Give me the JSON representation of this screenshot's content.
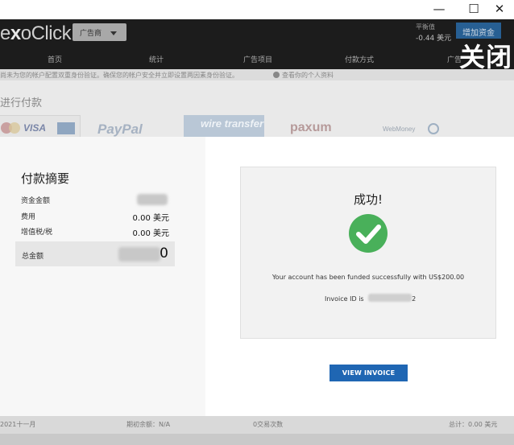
{
  "window": {
    "minimize": "—",
    "maximize": "☐",
    "close": "✕"
  },
  "header": {
    "logo_prefix": "e",
    "logo_mid": "x",
    "logo_rest": "oClick",
    "account_type": "广告商",
    "balance_label": "平衡值",
    "balance_value": "-0.44 美元",
    "add_funds": "增加资金",
    "close_overlay": "关闭",
    "nav": [
      "首页",
      "统计",
      "广告项目",
      "付款方式",
      "广告"
    ]
  },
  "notice": {
    "text": "尚未为您的帐户配置双重身份验证。确保您的帐户安全并立即设置两因素身份验证。",
    "profile_link": "查看你的个人资料"
  },
  "payments": {
    "heading": "进行付款",
    "methods": [
      "VISA",
      "PayPal",
      "wire transfer",
      "paxum",
      "WebMoney"
    ]
  },
  "summary": {
    "title": "付款摘要",
    "rows": [
      {
        "label": "资金金额",
        "value": ""
      },
      {
        "label": "费用",
        "value": "0.00 美元"
      },
      {
        "label": "增值税/税",
        "value": "0.00 美元"
      }
    ],
    "total_label": "总金额",
    "total_value_tail": "0"
  },
  "result": {
    "title": "成功!",
    "message": "Your account has been funded successfully with US$200.00",
    "invoice_label": "Invoice ID is",
    "invoice_tail": "2",
    "button": "VIEW INVOICE"
  },
  "footer": {
    "month": "2021十一月",
    "opening_balance": "期初余额：N/A",
    "transactions": "0交易次数",
    "total": "总计：0.00 美元"
  },
  "colors": {
    "accent": "#1f66b3",
    "success": "#49b05a"
  }
}
